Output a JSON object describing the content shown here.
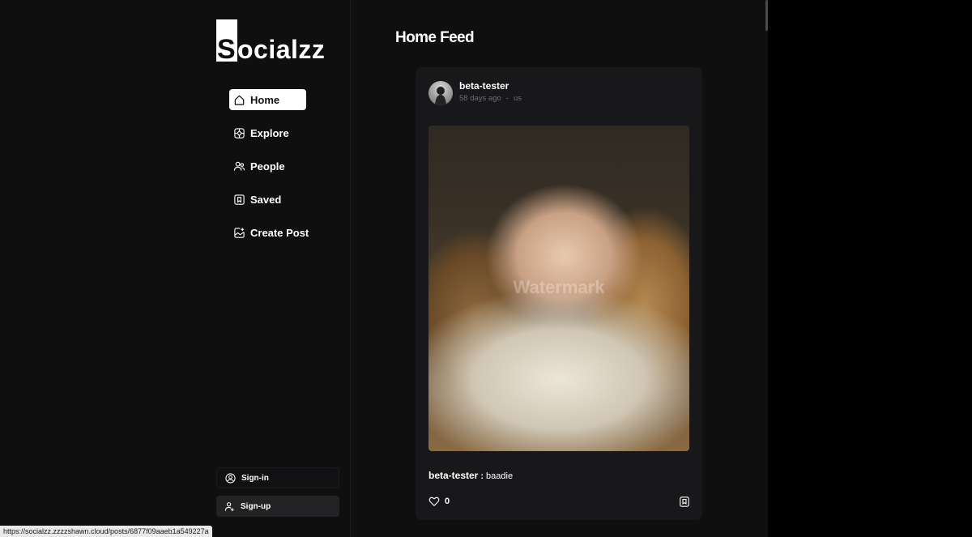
{
  "brand": {
    "logo_initial": "S",
    "logo_rest": "ocialzz"
  },
  "sidebar": {
    "items": [
      {
        "label": "Home",
        "icon": "home-icon",
        "active": true
      },
      {
        "label": "Explore",
        "icon": "explore-icon",
        "active": false
      },
      {
        "label": "People",
        "icon": "people-icon",
        "active": false
      },
      {
        "label": "Saved",
        "icon": "bookmark-icon",
        "active": false
      },
      {
        "label": "Create Post",
        "icon": "create-post-icon",
        "active": false
      }
    ],
    "signin_label": "Sign-in",
    "signup_label": "Sign-up"
  },
  "main": {
    "title": "Home Feed"
  },
  "post": {
    "username": "beta-tester",
    "time_ago": "58 days ago",
    "separator": "-",
    "location": "us",
    "image_watermark": "Watermark",
    "caption_user": "beta-tester",
    "caption_sep": ":",
    "caption_text": "baadie",
    "like_count": "0"
  },
  "status_bar": {
    "url": "https://socialzz.zzzzshawn.cloud/posts/6877f09aaeb1a549227a"
  },
  "colors": {
    "background": "#0f0f10",
    "card": "#18181b",
    "active_nav": "#ffffff",
    "meta_text": "#6b6b80"
  }
}
